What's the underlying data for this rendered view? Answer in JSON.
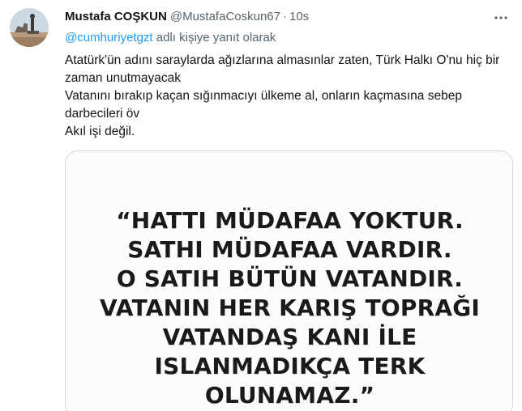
{
  "user": {
    "name": "Mustafa COŞKUN",
    "handle": "@MustafaCoskun67",
    "separator": "·",
    "time": "10s"
  },
  "reply": {
    "mention": "@cumhuriyetgzt",
    "suffix": " adlı kişiye yanıt olarak"
  },
  "body": {
    "lines": [
      "Atatürk'ün adını saraylarda ağızlarına almasınlar zaten, Türk Halkı O'nu hiç bir zaman unutmayacak",
      "Vatanını bırakıp kaçan sığınmacıyı ülkeme al, onların kaçmasına sebep darbecileri öv",
      "Akıl işi değil."
    ]
  },
  "media": {
    "quote_lines": [
      "“HATTI MÜDAFAA YOKTUR.",
      "SATHI MÜDAFAA VARDIR.",
      "O SATIH BÜTÜN VATANDIR.",
      "VATANIN HER KARIŞ TOPRAĞI",
      "VATANDAŞ KANI İLE",
      "ISLANMADIKÇA TERK",
      "OLUNAMAZ.”"
    ]
  },
  "icons": {
    "more": "more-options-icon",
    "avatar": "avatar"
  },
  "colors": {
    "link": "#1d9bf0",
    "secondary_text": "#536471",
    "primary_text": "#0f1419",
    "border": "#cfd9de"
  }
}
